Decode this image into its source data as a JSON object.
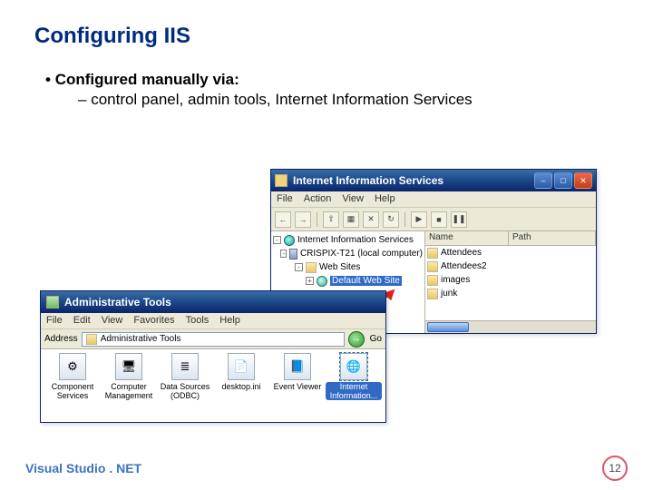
{
  "slide": {
    "title": "Configuring IIS",
    "bullet1_prefix": "• ",
    "bullet1": "Configured manually via:",
    "bullet2_prefix": "– ",
    "bullet2": "control panel, admin tools, Internet Information Services",
    "footer": "Visual Studio . NET",
    "page_number": "12"
  },
  "iis_window": {
    "title": "Internet Information Services",
    "menus": [
      "File",
      "Action",
      "View",
      "Help"
    ],
    "tree": {
      "root": "Internet Information Services",
      "computer": "CRISPIX-T21 (local computer)",
      "sites_folder": "Web Sites",
      "default_site": "Default Web Site"
    },
    "list": {
      "col_name": "Name",
      "col_path": "Path",
      "items": [
        "Attendees",
        "Attendees2",
        "images",
        "junk"
      ]
    }
  },
  "admin_tools_window": {
    "title": "Administrative Tools",
    "menus": [
      "File",
      "Edit",
      "View",
      "Favorites",
      "Tools",
      "Help"
    ],
    "address_label": "Address",
    "address_value": "Administrative Tools",
    "go_label": "Go",
    "items": [
      {
        "label": "Component Services"
      },
      {
        "label": "Computer Management"
      },
      {
        "label": "Data Sources (ODBC)"
      },
      {
        "label": "desktop.ini"
      },
      {
        "label": "Event Viewer"
      },
      {
        "label": "Internet Information..."
      }
    ],
    "selected_index": 5
  }
}
